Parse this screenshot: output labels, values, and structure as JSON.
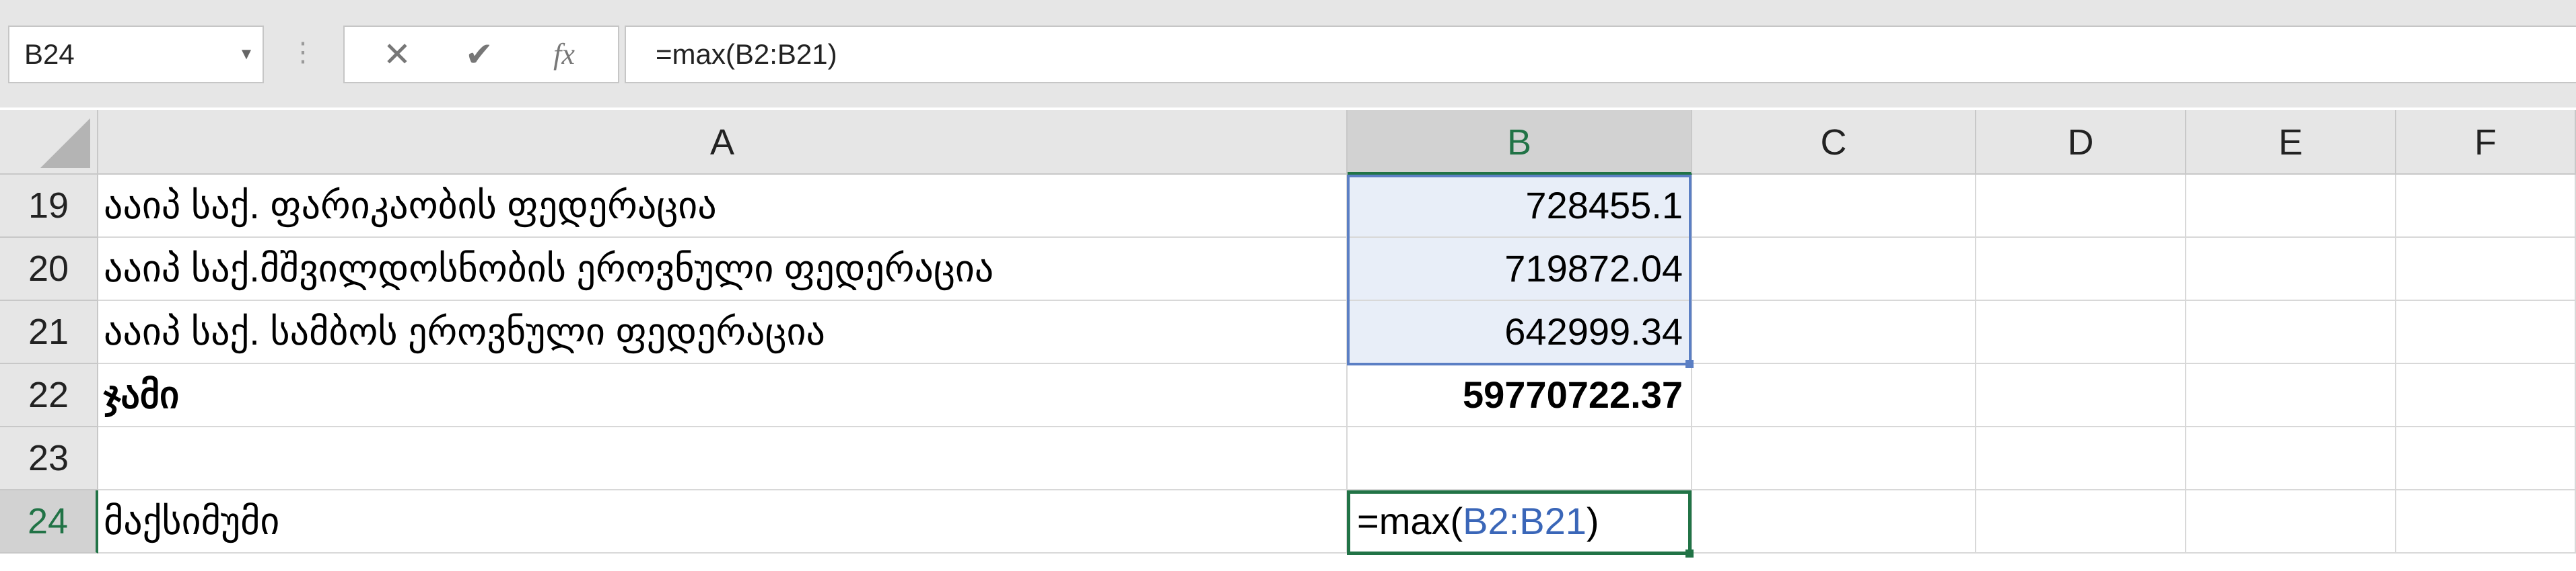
{
  "name_box": {
    "value": "B24"
  },
  "formula_bar": {
    "cancel_glyph": "✕",
    "enter_glyph": "✔",
    "function_label": "fx",
    "formula": "=max(B2:B21)"
  },
  "columns": [
    "A",
    "B",
    "C",
    "D",
    "E",
    "F"
  ],
  "rows": [
    {
      "num": "19",
      "a": "ააიპ საქ. ფარიკაობის ფედერაცია",
      "b": "728455.1"
    },
    {
      "num": "20",
      "a": "ააიპ  საქ.მშვილდოსნობის ეროვნული ფედერაცია",
      "b": "719872.04"
    },
    {
      "num": "21",
      "a": "ააიპ   საქ. სამბოს ეროვნული ფედერაცია",
      "b": "642999.34"
    },
    {
      "num": "22",
      "a": "ჯამი",
      "b": "59770722.37"
    },
    {
      "num": "23",
      "a": "",
      "b": ""
    },
    {
      "num": "24",
      "a": "მაქსიმუმი",
      "b": ""
    }
  ],
  "active_cell": {
    "prefix": "=max(",
    "ref": "B2:B21",
    "suffix": ")"
  },
  "colors": {
    "excel_green": "#217346",
    "selection_blue": "#5b7fc4",
    "range_fill": "#e8eef8"
  }
}
